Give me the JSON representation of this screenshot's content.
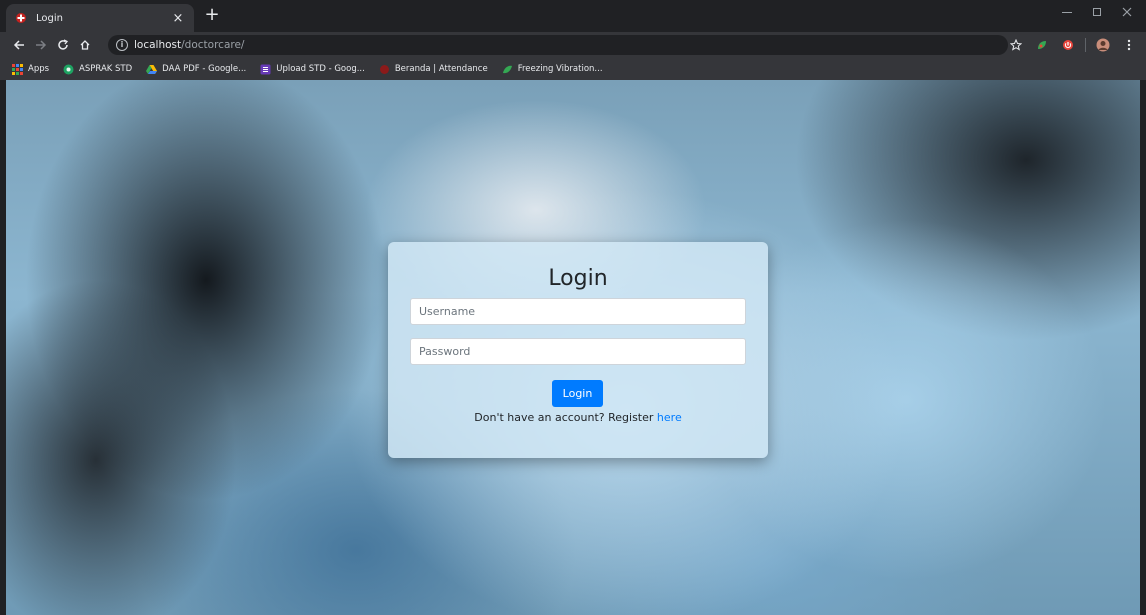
{
  "browser": {
    "tab_title": "Login",
    "tab_close": "×",
    "new_tab": "+",
    "url_host": "localhost",
    "url_path": "/doctorcare/",
    "bookmarks": [
      {
        "label": "Apps",
        "icon": "apps-grid-icon",
        "color": "#4285f4"
      },
      {
        "label": "ASPRAK STD",
        "icon": "aspraks-favicon-icon",
        "color": "#1ea362"
      },
      {
        "label": "DAA PDF - Google...",
        "icon": "google-drive-icon",
        "color": "#fbbc04"
      },
      {
        "label": "Upload STD - Goog...",
        "icon": "google-forms-icon",
        "color": "#673ab7"
      },
      {
        "label": "Beranda | Attendance",
        "icon": "attendance-favicon-icon",
        "color": "#c5221f"
      },
      {
        "label": "Freezing Vibration...",
        "icon": "freezing-favicon-icon",
        "color": "#34a853"
      }
    ]
  },
  "login": {
    "title": "Login",
    "username_placeholder": "Username",
    "password_placeholder": "Password",
    "submit_label": "Login",
    "register_text": "Don't have an account? Register ",
    "register_link": "here"
  },
  "colors": {
    "primary": "#007bff",
    "chrome_dark": "#202124",
    "chrome_toolbar": "#35363a"
  }
}
